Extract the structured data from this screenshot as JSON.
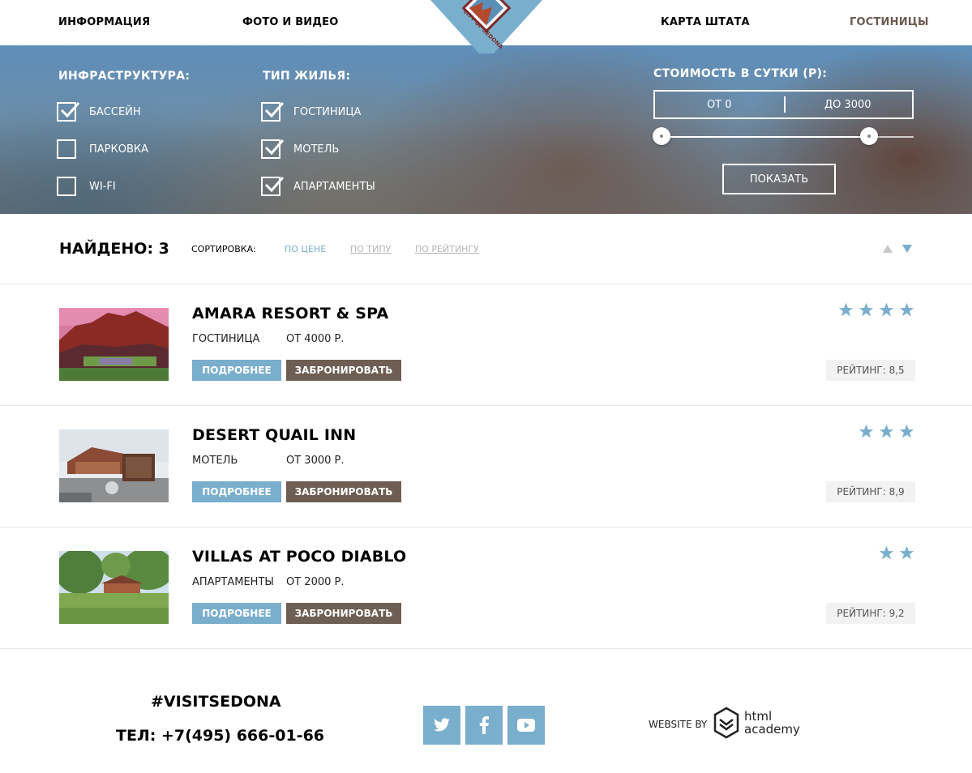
{
  "nav": {
    "left": [
      "ИНФОРМАЦИЯ",
      "ФОТО И ВИДЕО"
    ],
    "right": [
      "КАРТА ШТАТА",
      "ГОСТИНИЦЫ"
    ],
    "logo_text": "CITY OF SEDONA"
  },
  "filters": {
    "infrastructure": {
      "title": "ИНФРАСТРУКТУРА:",
      "options": [
        {
          "label": "БАССЕЙН",
          "checked": true
        },
        {
          "label": "ПАРКОВКА",
          "checked": false
        },
        {
          "label": "WI-FI",
          "checked": false
        }
      ]
    },
    "housing_type": {
      "title": "ТИП ЖИЛЬЯ:",
      "options": [
        {
          "label": "ГОСТИНИЦА",
          "checked": true
        },
        {
          "label": "МОТЕЛЬ",
          "checked": true
        },
        {
          "label": "АПАРТАМЕНТЫ",
          "checked": true
        }
      ]
    },
    "price": {
      "title": "СТОИМОСТЬ В СУТКИ (Р):",
      "from": "ОТ 0",
      "to": "ДО 3000",
      "slider_min_fraction": 0.03,
      "slider_max_fraction": 0.83
    },
    "show_label": "ПОКАЗАТЬ"
  },
  "results": {
    "found": "НАЙДЕНО: 3",
    "sort_label": "СОРТИРОВКА:",
    "sort_options": [
      "ПО ЦЕНЕ",
      "ПО ТИПУ",
      "ПО РЕЙТИНГУ"
    ],
    "active_sort": 0
  },
  "hotels": [
    {
      "name": "AMARA RESORT & SPA",
      "type": "ГОСТИНИЦА",
      "price": "ОТ 4000 Р.",
      "stars": 4,
      "rating": "РЕЙТИНГ: 8,5"
    },
    {
      "name": "DESERT QUAIL INN",
      "type": "МОТЕЛЬ",
      "price": "ОТ 3000 Р.",
      "stars": 3,
      "rating": "РЕЙТИНГ: 8,9"
    },
    {
      "name": "VILLAS AT POCO DIABLO",
      "type": "АПАРТАМЕНТЫ",
      "price": "ОТ 2000 Р.",
      "stars": 2,
      "rating": "РЕЙТИНГ: 9,2"
    }
  ],
  "buttons": {
    "more": "ПОДРОБНЕЕ",
    "book": "ЗАБРОНИРОВАТЬ"
  },
  "footer": {
    "hashtag": "#VISITSEDONA",
    "phone": "ТЕЛ: +7(495) 666-01-66",
    "social": [
      "twitter-icon",
      "facebook-icon",
      "youtube-icon"
    ],
    "website_by": "WEBSITE BY",
    "academy_line1": "html",
    "academy_line2": "academy"
  },
  "colors": {
    "accent": "#7aaecd",
    "brown": "#6e5e53",
    "active_nav": "#6b5a4f"
  }
}
